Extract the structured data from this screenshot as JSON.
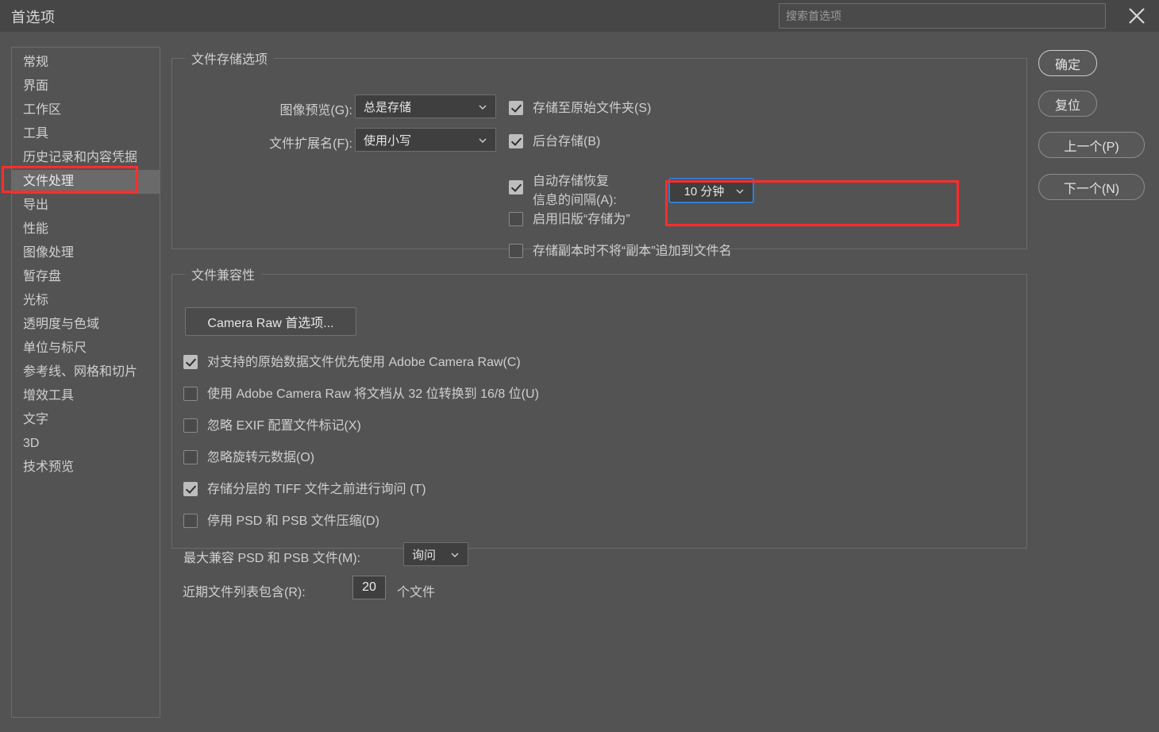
{
  "window": {
    "title": "首选项",
    "close_icon": "close-icon"
  },
  "search": {
    "placeholder": "搜索首选项",
    "value": ""
  },
  "sidebar": {
    "items": [
      {
        "label": "常规",
        "selected": false
      },
      {
        "label": "界面",
        "selected": false
      },
      {
        "label": "工作区",
        "selected": false
      },
      {
        "label": "工具",
        "selected": false
      },
      {
        "label": "历史记录和内容凭据",
        "selected": false
      },
      {
        "label": "文件处理",
        "selected": true
      },
      {
        "label": "导出",
        "selected": false
      },
      {
        "label": "性能",
        "selected": false
      },
      {
        "label": "图像处理",
        "selected": false
      },
      {
        "label": "暂存盘",
        "selected": false
      },
      {
        "label": "光标",
        "selected": false
      },
      {
        "label": "透明度与色域",
        "selected": false
      },
      {
        "label": "单位与标尺",
        "selected": false
      },
      {
        "label": "参考线、网格和切片",
        "selected": false
      },
      {
        "label": "增效工具",
        "selected": false
      },
      {
        "label": "文字",
        "selected": false
      },
      {
        "label": "3D",
        "selected": false
      },
      {
        "label": "技术预览",
        "selected": false
      }
    ]
  },
  "file_saving": {
    "legend": "文件存储选项",
    "image_preview_label": "图像预览(G):",
    "image_preview_value": "总是存储",
    "file_extension_label": "文件扩展名(F):",
    "file_extension_value": "使用小写",
    "save_to_original_label": "存储至原始文件夹(S)",
    "save_to_original_checked": true,
    "background_save_label": "后台存储(B)",
    "background_save_checked": true,
    "autosave_label_line1": "自动存储恢复",
    "autosave_label_line2": "信息的间隔(A):",
    "autosave_checked": true,
    "autosave_interval_value": "10 分钟",
    "legacy_save_as_label": "启用旧版“存储为”",
    "legacy_save_as_checked": false,
    "no_copy_suffix_label": "存储副本时不将“副本”追加到文件名",
    "no_copy_suffix_checked": false
  },
  "file_compatibility": {
    "legend": "文件兼容性",
    "camera_raw_button": "Camera Raw 首选项...",
    "prefer_acr_label": "对支持的原始数据文件优先使用 Adobe Camera Raw(C)",
    "prefer_acr_checked": true,
    "convert_32bit_label": "使用 Adobe Camera Raw 将文档从 32 位转换到 16/8 位(U)",
    "convert_32bit_checked": false,
    "ignore_exif_label": "忽略 EXIF 配置文件标记(X)",
    "ignore_exif_checked": false,
    "ignore_rotation_label": "忽略旋转元数据(O)",
    "ignore_rotation_checked": false,
    "ask_tiff_label": "存储分层的 TIFF 文件之前进行询问 (T)",
    "ask_tiff_checked": true,
    "disable_compression_label": "停用 PSD 和 PSB 文件压缩(D)",
    "disable_compression_checked": false,
    "max_compat_label": "最大兼容 PSD 和 PSB 文件(M):",
    "max_compat_value": "询问"
  },
  "recent_files": {
    "label": "近期文件列表包含(R):",
    "value": "20",
    "suffix": "个文件"
  },
  "buttons": {
    "ok": "确定",
    "reset": "复位",
    "prev": "上一个(P)",
    "next": "下一个(N)"
  },
  "annotations": {
    "highlight_color": "#ff2d2d",
    "focus_color": "#2d7fd3"
  }
}
